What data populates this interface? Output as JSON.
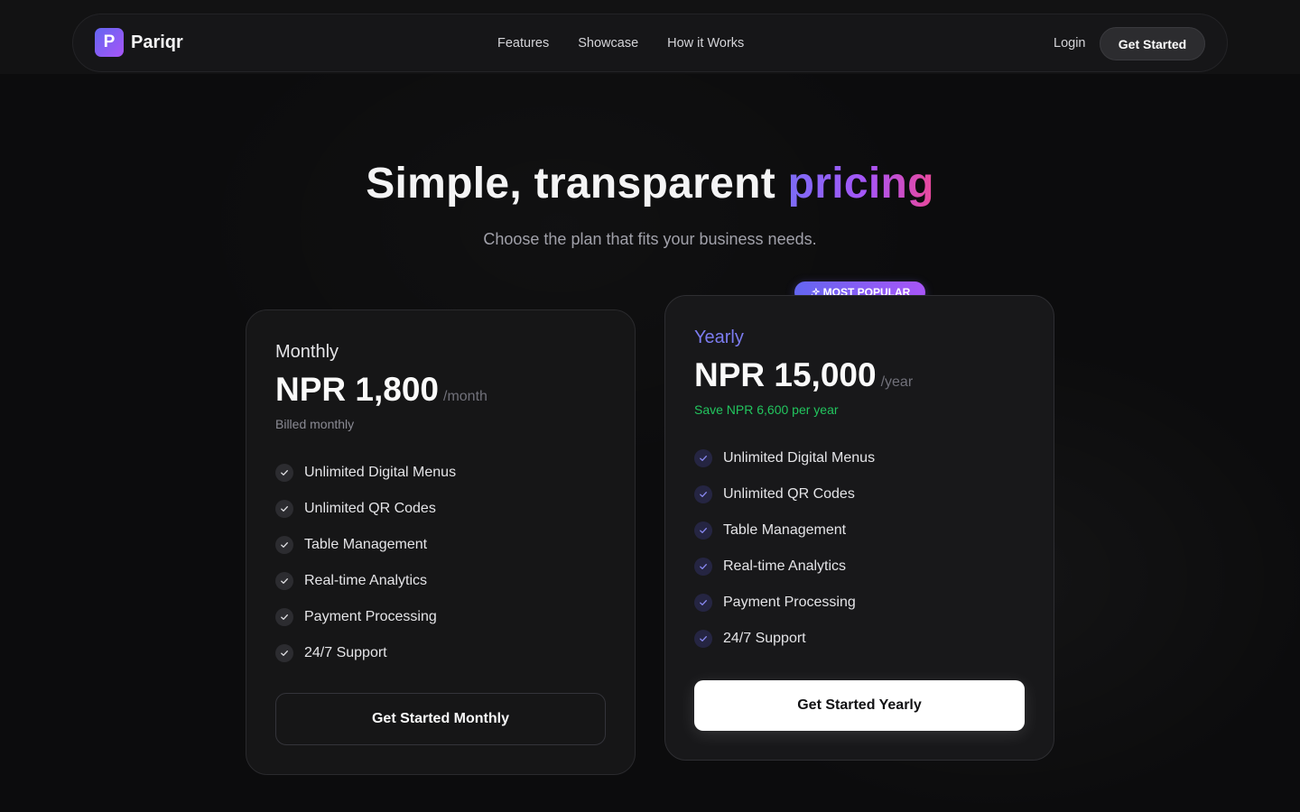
{
  "nav": {
    "logo_letter": "P",
    "brand": "Pariqr",
    "links": [
      "Features",
      "Showcase",
      "How it Works"
    ],
    "login_label": "Login",
    "cta_label": "Get Started"
  },
  "hero": {
    "title_plain": "Simple, transparent ",
    "title_highlight": "pricing",
    "subtitle": "Choose the plan that fits your business needs."
  },
  "plans": [
    {
      "name": "Monthly",
      "price": "NPR 1,800",
      "period": "/month",
      "note": "Billed monthly",
      "features": [
        "Unlimited Digital Menus",
        "Unlimited QR Codes",
        "Table Management",
        "Real-time Analytics",
        "Payment Processing",
        "24/7 Support"
      ],
      "cta": "Get Started Monthly"
    },
    {
      "badge": "MOST POPULAR",
      "name": "Yearly",
      "price": "NPR 15,000",
      "period": "/year",
      "note": "Save NPR 6,600 per year",
      "features": [
        "Unlimited Digital Menus",
        "Unlimited QR Codes",
        "Table Management",
        "Real-time Analytics",
        "Payment Processing",
        "24/7 Support"
      ],
      "cta": "Get Started Yearly"
    }
  ],
  "colors": {
    "accent": "#6366f1",
    "accent_2": "#a855f7",
    "highlight_end": "#ec4899",
    "savings_green": "#22c55e"
  },
  "icons": {
    "feature_check": "check-icon",
    "badge": "sparkles-icon"
  }
}
